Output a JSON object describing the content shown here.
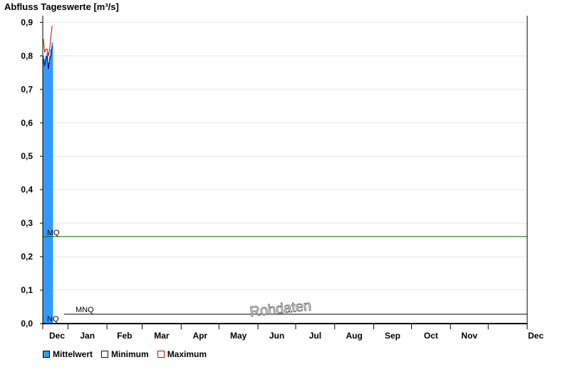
{
  "chart_data": {
    "type": "bar",
    "title": "Abfluss Tageswerte [m³/s]",
    "ylim": [
      0,
      0.92
    ],
    "yticks": [
      "0,0",
      "0,1",
      "0,2",
      "0,3",
      "0,4",
      "0,5",
      "0,6",
      "0,7",
      "0,8",
      "0,9"
    ],
    "ytick_values": [
      0,
      0.1,
      0.2,
      0.3,
      0.4,
      0.5,
      0.6,
      0.7,
      0.8,
      0.9
    ],
    "months": [
      "Dec",
      "Jan",
      "Feb",
      "Mar",
      "Apr",
      "May",
      "Jun",
      "Jul",
      "Aug",
      "Sep",
      "Oct",
      "Nov",
      "Dec"
    ],
    "month_days": [
      31,
      31,
      28,
      31,
      30,
      31,
      30,
      31,
      31,
      30,
      31,
      30,
      31
    ],
    "start_day": 12,
    "grid": true,
    "legend_placement": "bottom-left",
    "series": [
      {
        "name": "Mittelwert",
        "color": "#3399ff",
        "kind": "bar",
        "values": [
          0.8,
          0.79,
          0.8,
          0.81,
          0.78,
          0.8,
          0.82,
          0.84
        ]
      },
      {
        "name": "Minimum",
        "color": "#000080",
        "kind": "line",
        "values": [
          0.79,
          0.77,
          0.79,
          0.8,
          0.76,
          0.79,
          0.8,
          0.83
        ]
      },
      {
        "name": "Maximum",
        "color": "#cc0000",
        "kind": "line",
        "values": [
          0.85,
          0.81,
          0.82,
          0.82,
          0.8,
          0.82,
          0.86,
          0.89
        ]
      }
    ],
    "reference_lines": [
      {
        "label": "MQ",
        "value": 0.26,
        "color": "#006400"
      },
      {
        "label": "MNQ",
        "value": 0.028,
        "color": "#000000"
      },
      {
        "label": "NQ",
        "value": 0.0,
        "color": "#000000"
      }
    ],
    "watermark": "Rohdaten"
  }
}
